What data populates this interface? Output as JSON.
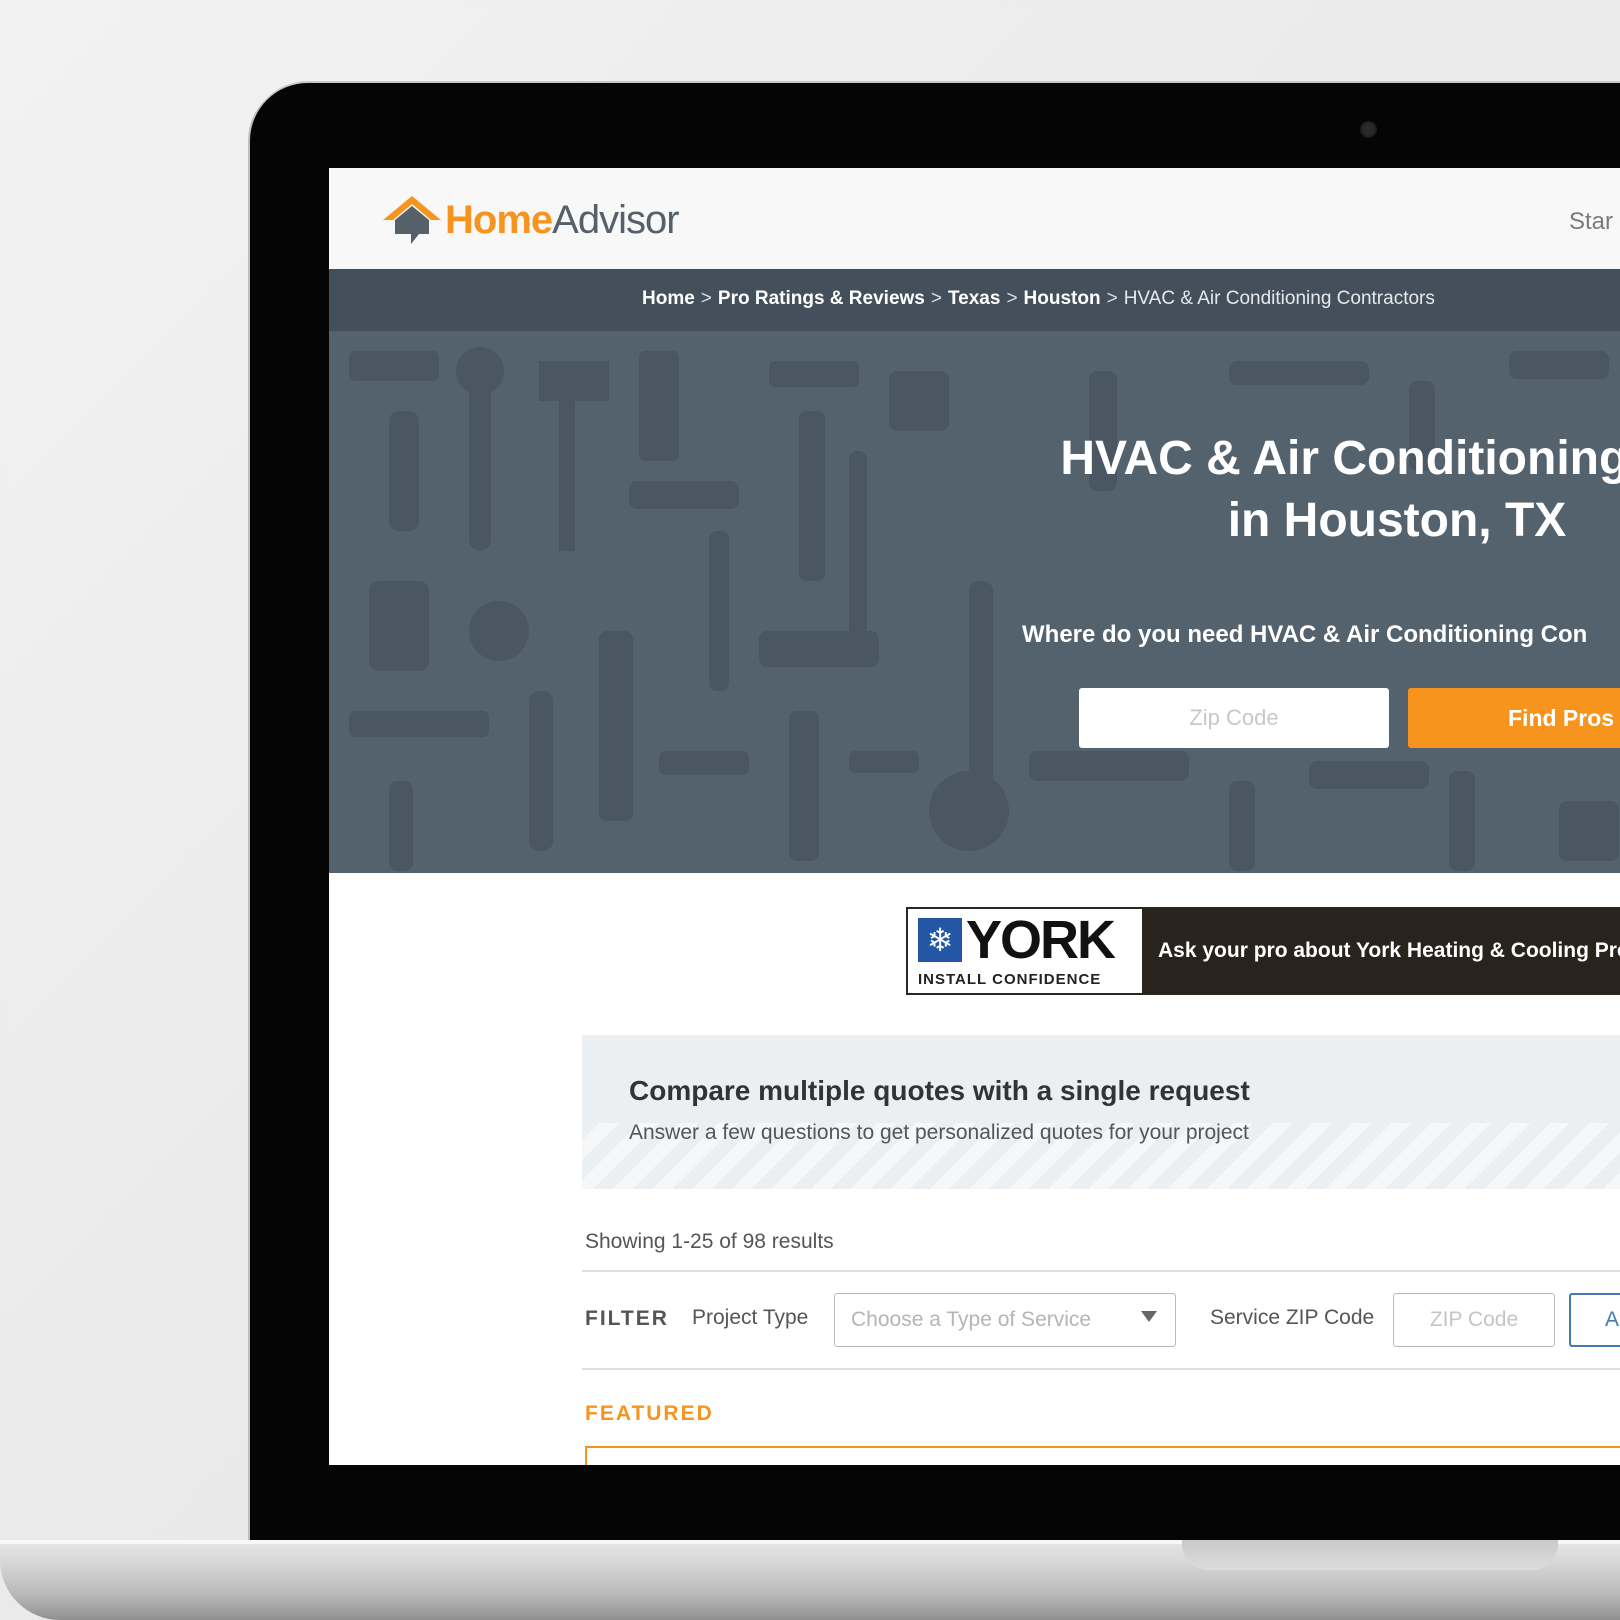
{
  "brand": {
    "logo_home": "Home",
    "logo_advisor": "Advisor",
    "colors": {
      "orange": "#f7941d",
      "slate": "#54626e",
      "dark_slate": "#434f5a",
      "link_blue": "#4479b3"
    }
  },
  "topbar": {
    "link_label": "Star"
  },
  "breadcrumb": {
    "items": [
      "Home",
      "Pro Ratings & Reviews",
      "Texas",
      "Houston"
    ],
    "separator": ">",
    "current": "HVAC & Air Conditioning Contractors"
  },
  "hero": {
    "title_line1": "HVAC & Air Conditioning Co",
    "title_line2": "in Houston, TX",
    "question": "Where do you need HVAC & Air Conditioning Con",
    "zip_placeholder": "Zip Code",
    "find_button": "Find Pros"
  },
  "ad": {
    "brand": "YORK",
    "tagline": "INSTALL CONFIDENCE",
    "message": "Ask your pro about York Heating & Cooling Prod"
  },
  "compare": {
    "title": "Compare multiple quotes with a single request",
    "subtitle": "Answer a few questions to get personalized quotes for your project"
  },
  "results": {
    "count_text": "Showing 1-25 of 98 results"
  },
  "filter": {
    "label": "FILTER",
    "project_type_label": "Project Type",
    "project_type_placeholder": "Choose a Type of Service",
    "zip_label": "Service ZIP Code",
    "zip_placeholder": "ZIP Code",
    "apply_button": "A"
  },
  "featured": {
    "label": "FEATURED"
  }
}
